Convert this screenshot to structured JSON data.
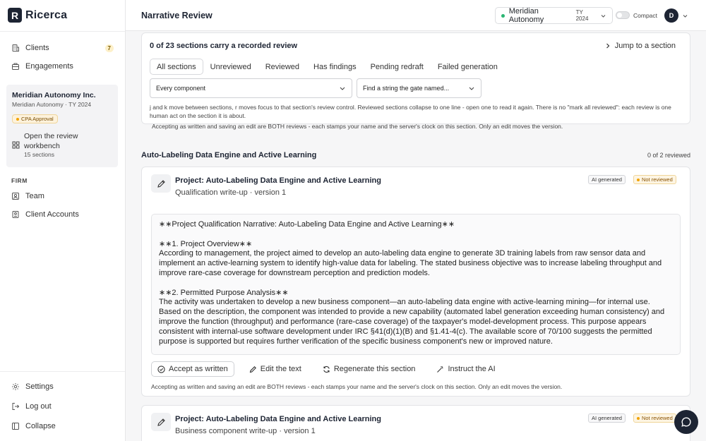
{
  "app": {
    "logo_letter": "R",
    "name": "Ricerca"
  },
  "sidebar": {
    "top_items": [
      {
        "label": "Clients",
        "icon": "building-icon",
        "count": "7"
      },
      {
        "label": "Engagements",
        "icon": "briefcase-icon"
      }
    ],
    "client_card": {
      "name": "Meridian Autonomy Inc.",
      "sub": "Meridian Autonomy · TY 2024",
      "badge": "CPA Approval",
      "open_label": "Open the review workbench",
      "open_sub": "15 sections"
    },
    "firm_label": "FIRM",
    "firm_items": [
      {
        "label": "Team",
        "icon": "users-icon"
      },
      {
        "label": "Client Accounts",
        "icon": "id-card-icon"
      }
    ],
    "bottom_items": [
      {
        "label": "Settings",
        "icon": "gear-icon"
      },
      {
        "label": "Log out",
        "icon": "logout-icon"
      },
      {
        "label": "Collapse",
        "icon": "collapse-icon"
      }
    ]
  },
  "topbar": {
    "title": "Narrative Review",
    "client_name": "Meridian Autonomy",
    "client_ty": "TY 2024",
    "compact_label": "Compact",
    "avatar_initial": "D"
  },
  "review_header": {
    "summary": "0 of 23 sections carry a recorded review",
    "jump_label": "Jump to a section",
    "tabs": [
      "All sections",
      "Unreviewed",
      "Reviewed",
      "Has findings",
      "Pending redraft",
      "Failed generation"
    ],
    "active_tab": "All sections",
    "component_select": "Every component",
    "gate_select": "Find a string the gate named...",
    "help_text": "j and k move between sections, r moves focus to that section's review control. Reviewed sections collapse to one line - open one to read it again. There is no \"mark all reviewed\": each review is one human act on the section it is about.",
    "accept_note": "Accepting as written and saving an edit are BOTH reviews - each stamps your name and the server's clock on this section. Only an edit moves the version."
  },
  "section": {
    "heading": "Auto-Labeling Data Engine and Active Learning",
    "count": "0 of 2 reviewed"
  },
  "cards": [
    {
      "title": "Project: Auto-Labeling Data Engine and Active Learning",
      "subtitle": "Qualification write-up · version 1",
      "ai_badge": "AI generated",
      "status_badge": "Not reviewed",
      "narrative": {
        "p1": "∗∗Project Qualification Narrative: Auto-Labeling Data Engine and Active Learning∗∗",
        "p2_head": "∗∗1. Project Overview∗∗",
        "p2_body": "According to management, the project aimed to develop an auto-labeling data engine to generate 3D training labels from raw sensor data and implement an active-learning system to identify high-value data for labeling. The stated business objective was to increase labeling throughput and improve rare-case coverage for downstream perception and prediction models.",
        "p3_head": "∗∗2. Permitted Purpose Analysis∗∗",
        "p3_body": "The activity was undertaken to develop a new business component—an auto-labeling data engine with active-learning mining—for internal use. Based on the description, the component was intended to provide a new capability (automated label generation exceeding human consistency) and improve the function (throughput) and performance (rare-case coverage) of the taxpayer's model-development process. This purpose appears consistent with internal-use software development under IRC §41(d)(1)(B) and §1.41-4(c). The available score of 70/100 suggests the permitted purpose is supported but requires further verification of the specific business component's new or improved nature."
      },
      "actions": {
        "accept": "Accept as written",
        "edit": "Edit the text",
        "regenerate": "Regenerate this section",
        "instruct": "Instruct the AI"
      },
      "accept_note": "Accepting as written and saving an edit are BOTH reviews - each stamps your name and the server's clock on this section. Only an edit moves the version."
    },
    {
      "title": "Project: Auto-Labeling Data Engine and Active Learning",
      "subtitle": "Business component write-up · version 1",
      "ai_badge": "AI generated",
      "status_badge": "Not reviewed"
    }
  ]
}
